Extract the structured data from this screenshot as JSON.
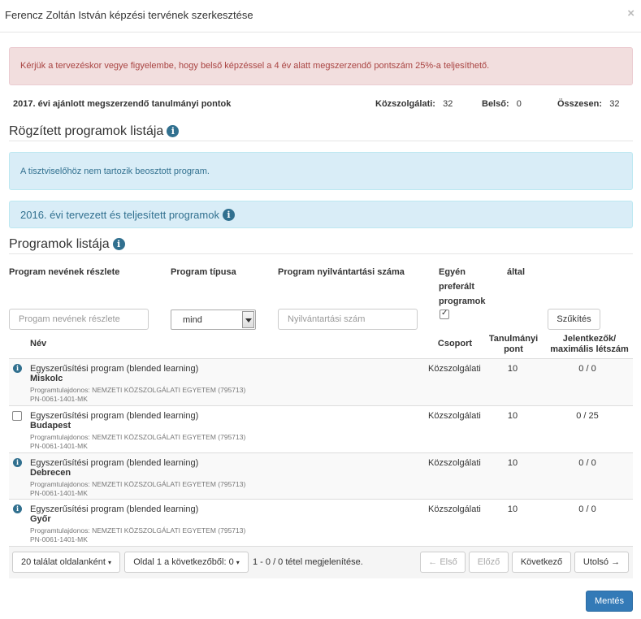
{
  "modal": {
    "title": "Ferencz Zoltán István képzési tervének szerkesztése",
    "close": "×"
  },
  "alert": "Kérjük a tervezéskor vegye figyelembe, hogy belső képzéssel a 4 év alatt megszerzendő pontszám 25%-a teljesíthető.",
  "points": {
    "title": "2017. évi ajánlott megszerzendő tanulmányi pontok",
    "public_label": "Közszolgálati:",
    "public_value": "32",
    "internal_label": "Belső:",
    "internal_value": "0",
    "total_label": "Összesen:",
    "total_value": "32"
  },
  "fixed_programs": {
    "title": "Rögzített programok listája",
    "info": "A tisztviselőhöz nem tartozik beosztott program."
  },
  "prev_year": {
    "title": "2016. évi tervezett és teljesített programok"
  },
  "program_list": {
    "title": "Programok listája"
  },
  "filters": {
    "name_label": "Program nevének részlete",
    "name_placeholder": "Progam nevének részlete",
    "type_label": "Program típusa",
    "type_value": "mind",
    "reg_label": "Program nyilvántartási száma",
    "reg_placeholder": "Nyilvántartási szám",
    "pref_label_1": "Egyén",
    "pref_label_2": "által",
    "pref_label_3": "preferált",
    "pref_label_4": "programok",
    "filter_button": "Szűkítés"
  },
  "table": {
    "headers": {
      "name": "Név",
      "group": "Csoport",
      "points_1": "Tanulmányi",
      "points_2": "pont",
      "reg_1": "Jelentkezők/",
      "reg_2": "maximális létszám"
    },
    "rows": [
      {
        "marker": "info",
        "name": "Egyszerűsítési program (blended learning)",
        "city": "Miskolc",
        "owner": "Programtulajdonos: NEMZETI KÖZSZOLGÁLATI EGYETEM (795713)",
        "code": "PN-0061-1401-MK",
        "group": "Közszolgálati",
        "points": "10",
        "registrations": "0 / 0"
      },
      {
        "marker": "checkbox",
        "name": "Egyszerűsítési program (blended learning)",
        "city": "Budapest",
        "owner": "Programtulajdonos: NEMZETI KÖZSZOLGÁLATI EGYETEM (795713)",
        "code": "PN-0061-1401-MK",
        "group": "Közszolgálati",
        "points": "10",
        "registrations": "0 / 25"
      },
      {
        "marker": "info",
        "name": "Egyszerűsítési program (blended learning)",
        "city": "Debrecen",
        "owner": "Programtulajdonos: NEMZETI KÖZSZOLGÁLATI EGYETEM (795713)",
        "code": "PN-0061-1401-MK",
        "group": "Közszolgálati",
        "points": "10",
        "registrations": "0 / 0"
      },
      {
        "marker": "info",
        "name": "Egyszerűsítési program (blended learning)",
        "city": "Győr",
        "owner": "Programtulajdonos: NEMZETI KÖZSZOLGÁLATI EGYETEM (795713)",
        "code": "PN-0061-1401-MK",
        "group": "Közszolgálati",
        "points": "10",
        "registrations": "0 / 0"
      }
    ]
  },
  "pagination": {
    "page_size": "20 találat oldalanként",
    "page_info": "Oldal 1 a következőből: 0",
    "count_text": "1 - 0 / 0 tétel megjelenítése.",
    "first": "← Első",
    "prev": "Előző",
    "next": "Következő",
    "last": "Utolsó →"
  },
  "save_button": "Mentés",
  "colors": {
    "danger_bg": "#f2dede",
    "danger_text": "#a94442",
    "info_bg": "#d9edf7",
    "info_text": "#31708f",
    "primary": "#337ab7"
  },
  "icons": {
    "info": "info-circle-icon",
    "caret": "caret-down-icon"
  }
}
